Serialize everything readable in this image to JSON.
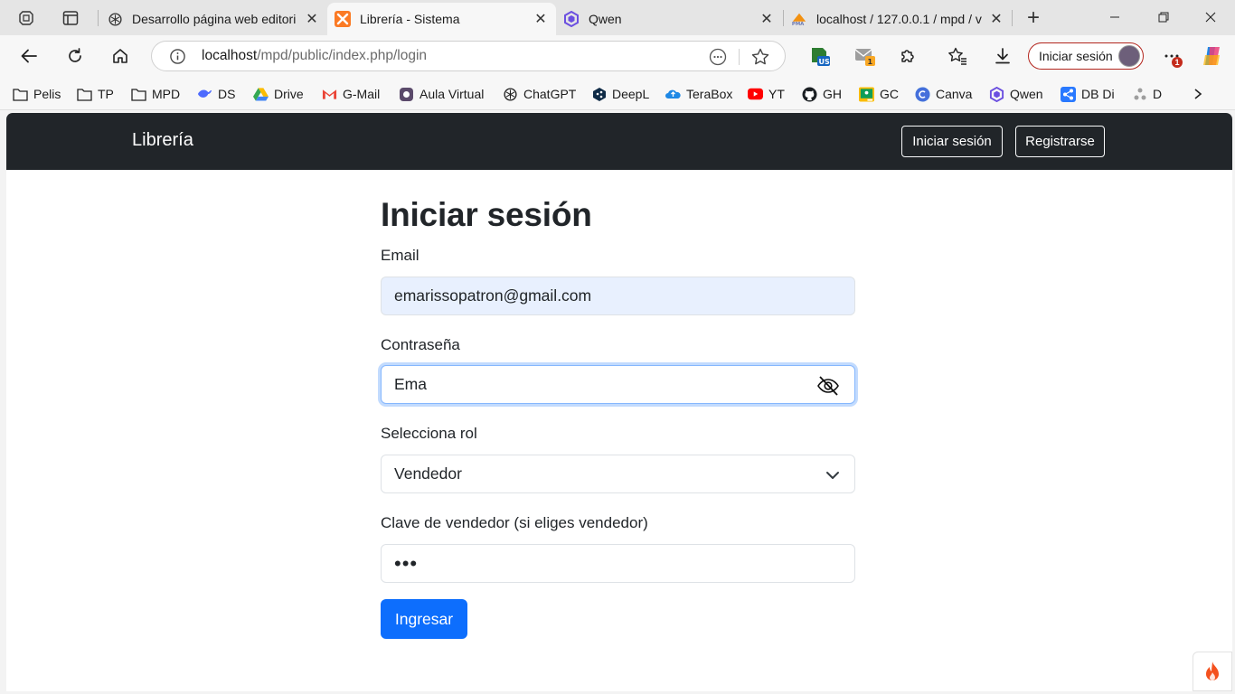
{
  "browser": {
    "tabs": [
      {
        "title": "Desarrollo página web editori",
        "icon": "chatgpt-icon",
        "active": false
      },
      {
        "title": "Librería - Sistema",
        "icon": "xampp-icon",
        "active": true
      },
      {
        "title": "Qwen",
        "icon": "qwen-icon",
        "active": false
      },
      {
        "title": "localhost / 127.0.0.1 / mpd / v",
        "icon": "phpmyadmin-icon",
        "active": false
      }
    ],
    "close_glyph": "✕",
    "new_tab_glyph": "+",
    "address": {
      "host": "localhost",
      "path": "/mpd/public/index.php/login"
    },
    "signin_label": "Iniciar sesión",
    "notification_badge": "1",
    "bookmarks": [
      {
        "label": "Pelis",
        "icon": "folder-icon"
      },
      {
        "label": "TP",
        "icon": "folder-icon"
      },
      {
        "label": "MPD",
        "icon": "folder-icon"
      },
      {
        "label": "DS",
        "icon": "deepseek-icon"
      },
      {
        "label": "Drive",
        "icon": "google-drive-icon"
      },
      {
        "label": "G-Mail",
        "icon": "gmail-icon"
      },
      {
        "label": "Aula Virtual",
        "icon": "aula-virtual-icon"
      },
      {
        "label": "ChatGPT",
        "icon": "chatgpt-icon"
      },
      {
        "label": "DeepL",
        "icon": "deepl-icon"
      },
      {
        "label": "TeraBox",
        "icon": "terabox-icon"
      },
      {
        "label": "YT",
        "icon": "youtube-icon"
      },
      {
        "label": "GH",
        "icon": "github-icon"
      },
      {
        "label": "GC",
        "icon": "google-classroom-icon"
      },
      {
        "label": "Canva",
        "icon": "canva-icon"
      },
      {
        "label": "Qwen",
        "icon": "qwen-icon"
      },
      {
        "label": "DB Di",
        "icon": "db-diagram-icon"
      },
      {
        "label": "D",
        "icon": "dots-app-icon"
      }
    ],
    "colors": {
      "signin_border": "#b3261e",
      "badge": "#c42b1c"
    }
  },
  "site": {
    "brand": "Librería",
    "nav": {
      "login": "Iniciar sesión",
      "register": "Registrarse"
    },
    "colors": {
      "navbar": "#212529",
      "primary": "#0d6efd",
      "autofill": "#e8f0fe"
    }
  },
  "form": {
    "title": "Iniciar sesión",
    "email": {
      "label": "Email",
      "value": "emarissopatron@gmail.com"
    },
    "password": {
      "label": "Contraseña",
      "value": "Ema",
      "visibility_icon": "eye-slash-icon"
    },
    "role": {
      "label": "Selecciona rol",
      "selected": "Vendedor"
    },
    "seller_key": {
      "label": "Clave de vendedor (si eliges vendedor)",
      "value": "•••"
    },
    "submit": "Ingresar"
  }
}
